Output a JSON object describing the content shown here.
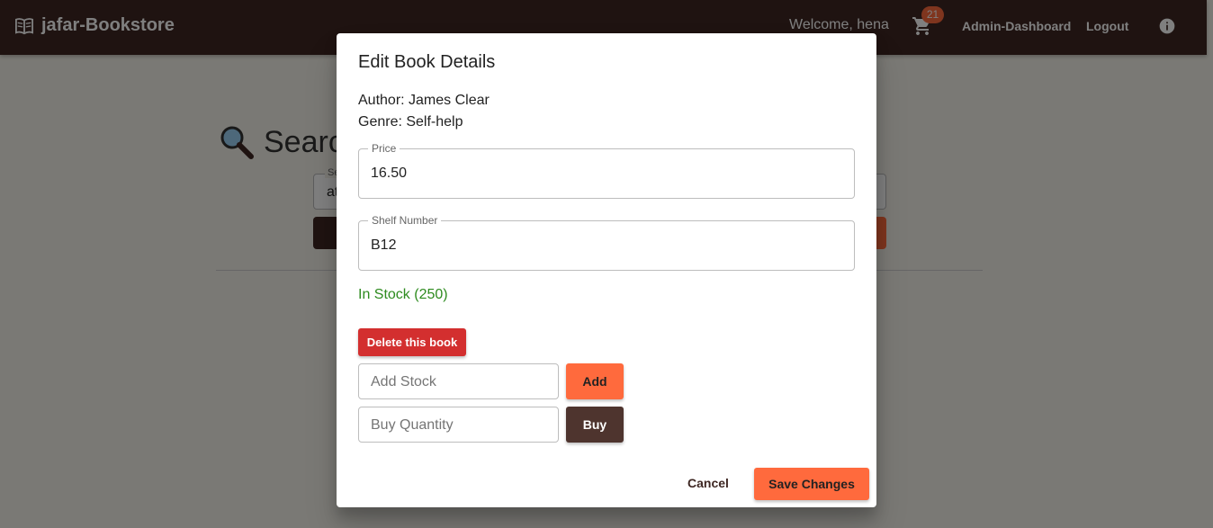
{
  "header": {
    "brand": "jafar-Bookstore",
    "welcome": "Welcome, hena",
    "cart_count": "21",
    "admin_link": "Admin-Dashboard",
    "logout_link": "Logout",
    "icons": {
      "brand": "book-icon",
      "cart": "cart-icon",
      "info": "info-icon"
    }
  },
  "page": {
    "search_title": "Search",
    "search_field": {
      "label": "Se",
      "value": "at"
    }
  },
  "dialog": {
    "title": "Edit Book Details",
    "author": "Author: James Clear",
    "genre": "Genre: Self-help",
    "price": {
      "label": "Price",
      "value": "16.50"
    },
    "shelf": {
      "label": "Shelf Number",
      "value": "B12"
    },
    "stock_status": "In Stock (250)",
    "delete_label": "Delete this book",
    "add_stock": {
      "placeholder": "Add Stock",
      "button": "Add"
    },
    "buy_quantity": {
      "placeholder": "Buy Quantity",
      "button": "Buy"
    },
    "cancel_label": "Cancel",
    "save_label": "Save Changes"
  },
  "colors": {
    "appbar": "#3e2723",
    "accent": "#ff6a3d",
    "delete": "#d32f2f",
    "in_stock": "#2e8b1f"
  }
}
